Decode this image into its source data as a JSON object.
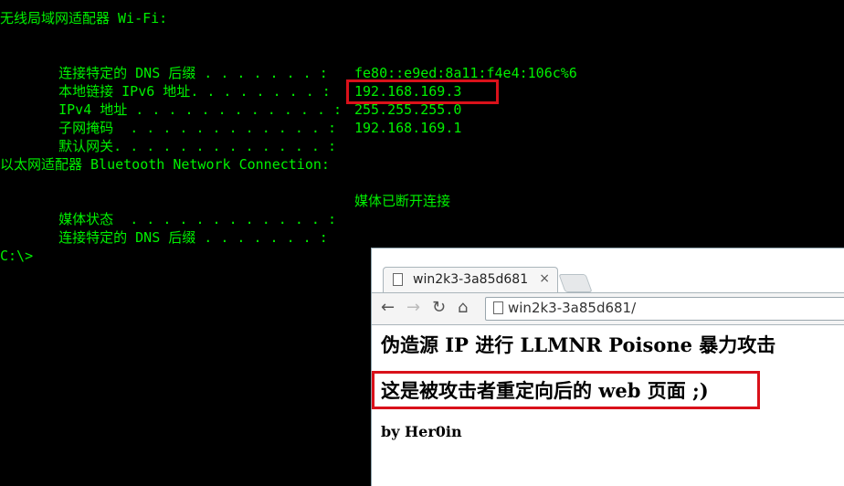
{
  "terminal": {
    "wifi_header": "无线局域网适配器 Wi-Fi:",
    "wifi": [
      {
        "label": "连接特定的 DNS 后缀",
        "dots": " . . . . . . . :",
        "value": ""
      },
      {
        "label": "本地链接 IPv6 地址",
        "dots": ". . . . . . . . :",
        "value": "fe80::e9ed:8a11:f4e4:106c%6"
      },
      {
        "label": "IPv4 地址",
        "dots": " . . . . . . . . . . . . :",
        "value": "192.168.169.3"
      },
      {
        "label": "子网掩码",
        "dots": "  . . . . . . . . . . . . :",
        "value": "255.255.255.0"
      },
      {
        "label": "默认网关",
        "dots": ". . . . . . . . . . . . . :",
        "value": "192.168.169.1"
      }
    ],
    "eth_header": "以太网适配器 Bluetooth Network Connection:",
    "eth": [
      {
        "label": "媒体状态",
        "dots": "  . . . . . . . . . . . . :",
        "value": "媒体已断开连接"
      },
      {
        "label": "连接特定的 DNS 后缀",
        "dots": " . . . . . . . :",
        "value": ""
      }
    ],
    "prompt": "C:\\>"
  },
  "browser": {
    "tab_title": "win2k3-3a85d681",
    "tab_close": "×",
    "address": "win2k3-3a85d681/",
    "page_heading": "伪造源 IP 进行 LLMNR Poisone 暴力攻击",
    "page_message": "这是被攻击者重定向后的 web 页面 ;)",
    "page_author": "by Her0in"
  },
  "colors": {
    "terminal_text": "#00f000",
    "highlight": "#d9111a"
  }
}
